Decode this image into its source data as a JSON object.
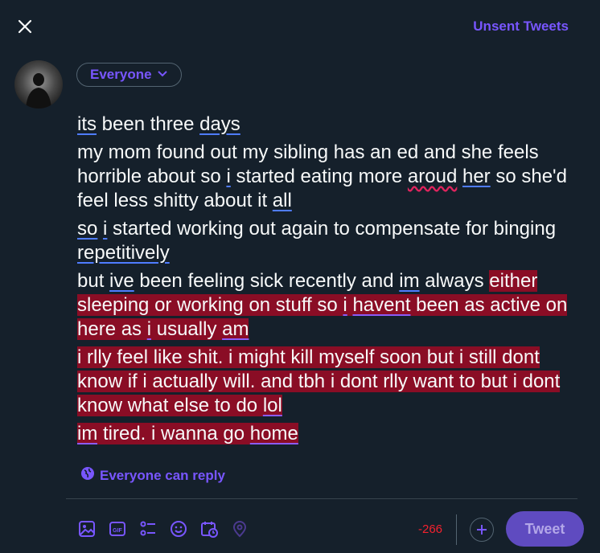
{
  "header": {
    "unsent_label": "Unsent Tweets"
  },
  "composer": {
    "audience_label": "Everyone",
    "paragraphs": [
      [
        {
          "t": "its",
          "u": "blue"
        },
        {
          "t": " been three "
        },
        {
          "t": "days",
          "u": "blue"
        }
      ],
      [
        {
          "t": "my mom found out my sibling has an ed and she feels horrible about so "
        },
        {
          "t": "i",
          "u": "blue"
        },
        {
          "t": " started eating more "
        },
        {
          "t": "aroud",
          "u": "red"
        },
        {
          "t": " "
        },
        {
          "t": "her",
          "u": "blue"
        },
        {
          "t": " so she'd feel less shitty about it "
        },
        {
          "t": "all",
          "u": "blue"
        }
      ],
      [
        {
          "t": "so",
          "u": "blue"
        },
        {
          "t": " "
        },
        {
          "t": "i",
          "u": "blue"
        },
        {
          "t": " started working out again to compensate for binging "
        },
        {
          "t": "repetitively",
          "u": "blue"
        }
      ],
      [
        {
          "t": "but "
        },
        {
          "t": "ive",
          "u": "blue"
        },
        {
          "t": " been feeling sick recently and "
        },
        {
          "t": "im",
          "u": "blue"
        },
        {
          "t": " always "
        },
        {
          "t": "either sleeping or working on stuff so ",
          "o": true
        },
        {
          "t": "i",
          "o": true,
          "u": "purple"
        },
        {
          "t": " ",
          "o": true
        },
        {
          "t": "havent",
          "o": true,
          "u": "purple"
        },
        {
          "t": " been as active on here as ",
          "o": true
        },
        {
          "t": "i",
          "o": true,
          "u": "purple"
        },
        {
          "t": " usually ",
          "o": true
        },
        {
          "t": "am",
          "o": true,
          "u": "purple"
        }
      ],
      [
        {
          "t": "i rlly feel like shit. i might kill myself soon but i still dont know if i actually will. and tbh i dont rlly want to but i dont know what else to do ",
          "o": true
        },
        {
          "t": "lol",
          "o": true,
          "u": "purple"
        }
      ],
      [
        {
          "t": "im",
          "o": true,
          "u": "purple"
        },
        {
          "t": " tired. i wanna go ",
          "o": true
        },
        {
          "t": "home",
          "o": true,
          "u": "purple"
        }
      ]
    ],
    "reply_setting": "Everyone can reply"
  },
  "toolbar": {
    "icons": [
      "image-icon",
      "gif-icon",
      "poll-icon",
      "emoji-icon",
      "schedule-icon",
      "location-icon"
    ],
    "char_counter": "-266",
    "tweet_label": "Tweet"
  },
  "colors": {
    "accent": "#7856ff",
    "overflow_bg": "#8a0d25",
    "background": "#15202b"
  }
}
